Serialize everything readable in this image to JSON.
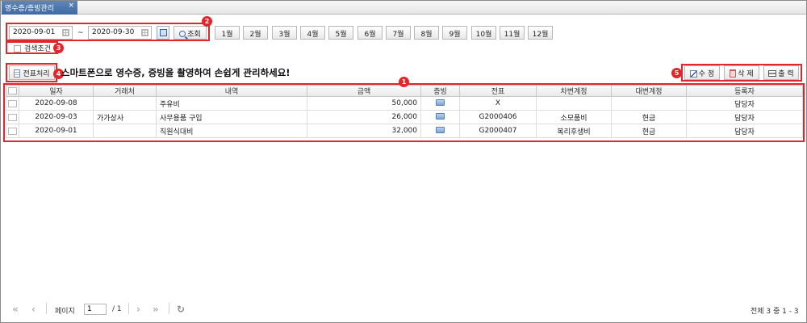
{
  "tab": {
    "title": "영수증/증빙관리",
    "close": "×"
  },
  "search": {
    "date_from": "2020-09-01",
    "tilde": "~",
    "date_to": "2020-09-30",
    "search_label": "조회",
    "months": [
      "1월",
      "2월",
      "3월",
      "4월",
      "5월",
      "6월",
      "7월",
      "8월",
      "9월",
      "10월",
      "11월",
      "12월"
    ]
  },
  "condition": {
    "label": "검색조건"
  },
  "toolbar": {
    "slip_label": "전표처리",
    "notice": "스마트폰으로 영수증, 증빙을 촬영하여 손쉽게 관리하세요!",
    "edit_label": "수 정",
    "delete_label": "삭 제",
    "print_label": "출 력"
  },
  "badges": [
    "1",
    "2",
    "3",
    "4",
    "5"
  ],
  "grid": {
    "columns": [
      "일자",
      "거래처",
      "내역",
      "금액",
      "증빙",
      "전표",
      "차변계정",
      "대변계정",
      "등록자"
    ],
    "rows": [
      {
        "date": "2020-09-08",
        "client": "",
        "desc": "주유비",
        "amount": "50,000",
        "proof": "proof-icon",
        "slip": "X",
        "debit": "",
        "credit": "",
        "user": "담당자"
      },
      {
        "date": "2020-09-03",
        "client": "가가상사",
        "desc": "사무용품 구입",
        "amount": "26,000",
        "proof": "proof-icon",
        "slip": "G2000406",
        "debit": "소모품비",
        "credit": "현금",
        "user": "담당자"
      },
      {
        "date": "2020-09-01",
        "client": "",
        "desc": "직원식대비",
        "amount": "32,000",
        "proof": "proof-icon",
        "slip": "G2000407",
        "debit": "복리후생비",
        "credit": "현금",
        "user": "담당자"
      }
    ]
  },
  "pager": {
    "page_label": "페이지",
    "page_value": "1",
    "page_total": "/ 1",
    "summary": "전체 3 중 1 - 3"
  },
  "colors": {
    "annotation": "#e3262a",
    "tab": "#4a74ab"
  }
}
